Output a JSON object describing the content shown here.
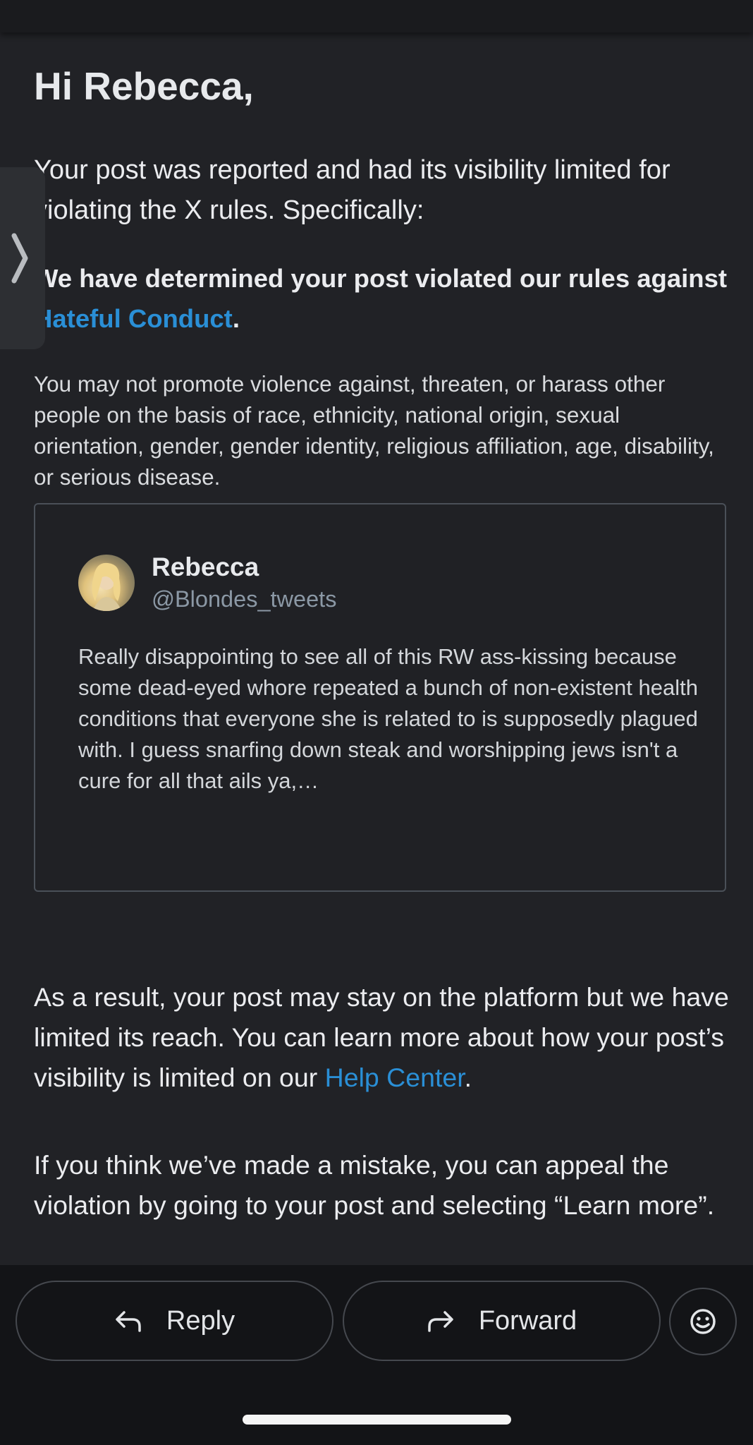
{
  "email": {
    "greeting": "Hi Rebecca,",
    "intro": "Your post was reported and had its visibility limited for violating the X rules. Specifically:",
    "rule_heading_prefix": "We have determined your post violated our rules against",
    "rule_link": "Hateful Conduct",
    "rule_heading_suffix": ".",
    "rule_description": "You may not promote violence against, threaten, or harass other people on the basis of race, ethnicity, national origin, sexual orientation, gender, gender identity, religious affiliation, age, disability, or serious disease.",
    "post": {
      "author_name": "Rebecca",
      "author_handle": "@Blondes_tweets",
      "text": "Really disappointing to see all of this RW ass-kissing because some dead-eyed whore repeated a bunch of non-existent health conditions that everyone she is related to is supposedly plagued with. I guess snarfing down steak and worshipping jews isn't a cure for all that ails ya,…"
    },
    "result_text": "As a result, your post may stay on the platform but we have limited its reach. You can learn more about how your post’s visibility is limited on our",
    "help_link": "Help Center",
    "result_suffix": ".",
    "appeal_text": "If you think we’ve made a mistake, you can appeal the violation by going to your post and selecting “Learn more”."
  },
  "actions": {
    "reply_label": "Reply",
    "forward_label": "Forward",
    "reply_icon": "reply-arrow-icon",
    "forward_icon": "forward-arrow-icon",
    "emoji_icon": "smiley-icon"
  },
  "side_handle_icon": "chevron-right-icon",
  "colors": {
    "link": "#2a8fd6",
    "background": "#212226",
    "bottom_bar": "#131417"
  }
}
